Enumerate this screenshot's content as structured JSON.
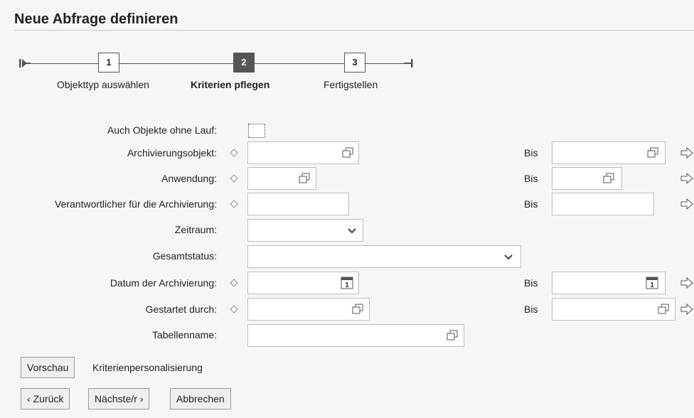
{
  "title": "Neue Abfrage definieren",
  "roadmap": {
    "steps": [
      {
        "number": "1",
        "label": "Objekttyp auswählen"
      },
      {
        "number": "2",
        "label": "Kriterien pflegen",
        "active": true
      },
      {
        "number": "3",
        "label": "Fertigstellen"
      }
    ]
  },
  "form": {
    "auch_objekte_label": "Auch Objekte ohne Lauf:",
    "archivierungsobjekt_label": "Archivierungsobjekt:",
    "anwendung_label": "Anwendung:",
    "verantwortlicher_label": "Verantwortlicher für die Archivierung:",
    "zeitraum_label": "Zeitraum:",
    "gesamtstatus_label": "Gesamtstatus:",
    "datum_label": "Datum der Archivierung:",
    "gestartet_label": "Gestartet durch:",
    "tabellenname_label": "Tabellenname:",
    "bis_label": "Bis",
    "zeitraum_value": "",
    "gesamtstatus_value": ""
  },
  "buttons": {
    "vorschau": "Vorschau",
    "kriterienpersonalisierung": "Kriterienpersonalisierung",
    "zurueck": "Zurück",
    "naechste": "Nächste/r",
    "abbrechen": "Abbrechen"
  }
}
